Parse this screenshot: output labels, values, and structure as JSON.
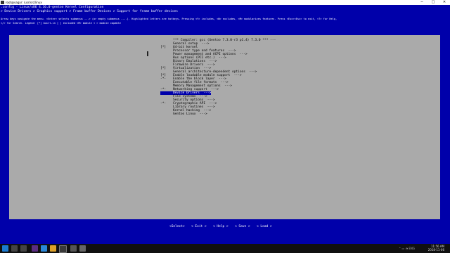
{
  "window": {
    "title": "root@vagyr: /usr/src/linux",
    "controls": [
      "─",
      "□",
      "✕"
    ]
  },
  "terminal": {
    "config_line": ".config - Linux/x86 4.16.0-gentoo Kernel Configuration",
    "breadcrumb": "> Device Drivers > Graphics support > Frame buffer Devices > Support for frame buffer devices",
    "help1": "Arrow keys navigate the menu.  <Enter> selects submenus ---> (or empty submenus ----).  Highlighted letters are hotkeys.  Pressing <Y> includes, <N> excludes, <M> modularizes features.  Press <Esc><Esc> to exit, <?> for Help,",
    "help2": "</> for Search.  Legend: [*] built-in  [ ] excluded  <M> module  < > module capable",
    "menu_title": "Linux/x86 4.16.0-gentoo Kernel Configuration",
    "items": [
      {
        "prefix": "",
        "text": "*** Compiler: gcc (Gentoo 7.3.0-r3 p1.4) 7.3.0 *** ---"
      },
      {
        "prefix": "",
        "text": "General setup  --->"
      },
      {
        "prefix": "[*]",
        "text": "64-bit kernel"
      },
      {
        "prefix": "",
        "text": "Processor type and features  --->"
      },
      {
        "prefix": "",
        "text": "Power management and ACPI options  --->"
      },
      {
        "prefix": "",
        "text": "Bus options (PCI etc.)  --->"
      },
      {
        "prefix": "",
        "text": "Binary Emulations  --->"
      },
      {
        "prefix": "",
        "text": "Firmware Drivers  --->"
      },
      {
        "prefix": "[*]",
        "text": "Virtualization  --->"
      },
      {
        "prefix": "",
        "text": "General architecture-dependent options  --->"
      },
      {
        "prefix": "[*]",
        "text": "Enable loadable module support  --->"
      },
      {
        "prefix": "-*-",
        "text": "Enable the block layer  --->"
      },
      {
        "prefix": "",
        "text": "Executable file formats  --->"
      },
      {
        "prefix": "",
        "text": "Memory Management options  --->"
      },
      {
        "prefix": "-*-",
        "text": "Networking support  --->"
      },
      {
        "prefix": "",
        "text": "Device Drivers  --->",
        "selected": true
      },
      {
        "prefix": "",
        "text": "File systems  --->"
      },
      {
        "prefix": "",
        "text": "Security options  --->"
      },
      {
        "prefix": "-*-",
        "text": "Cryptographic API  --->"
      },
      {
        "prefix": "",
        "text": "Library routines  --->"
      },
      {
        "prefix": "",
        "text": "Kernel hacking  --->"
      },
      {
        "prefix": "",
        "text": "Gentoo Linux  --->"
      }
    ],
    "buttons": [
      "<Select>",
      "< Exit >",
      "< Help >",
      "< Save >",
      "< Load >"
    ]
  },
  "taskbar": {
    "time": "11:56 AM",
    "date": "2018-11-06",
    "tray": "⌃  ▭  ◔  ENG"
  },
  "colors": {
    "terminal_bg": "#0000aa",
    "menu_bg": "#aaaaaa",
    "highlight": "#0000aa",
    "marker": "#00aa00"
  }
}
